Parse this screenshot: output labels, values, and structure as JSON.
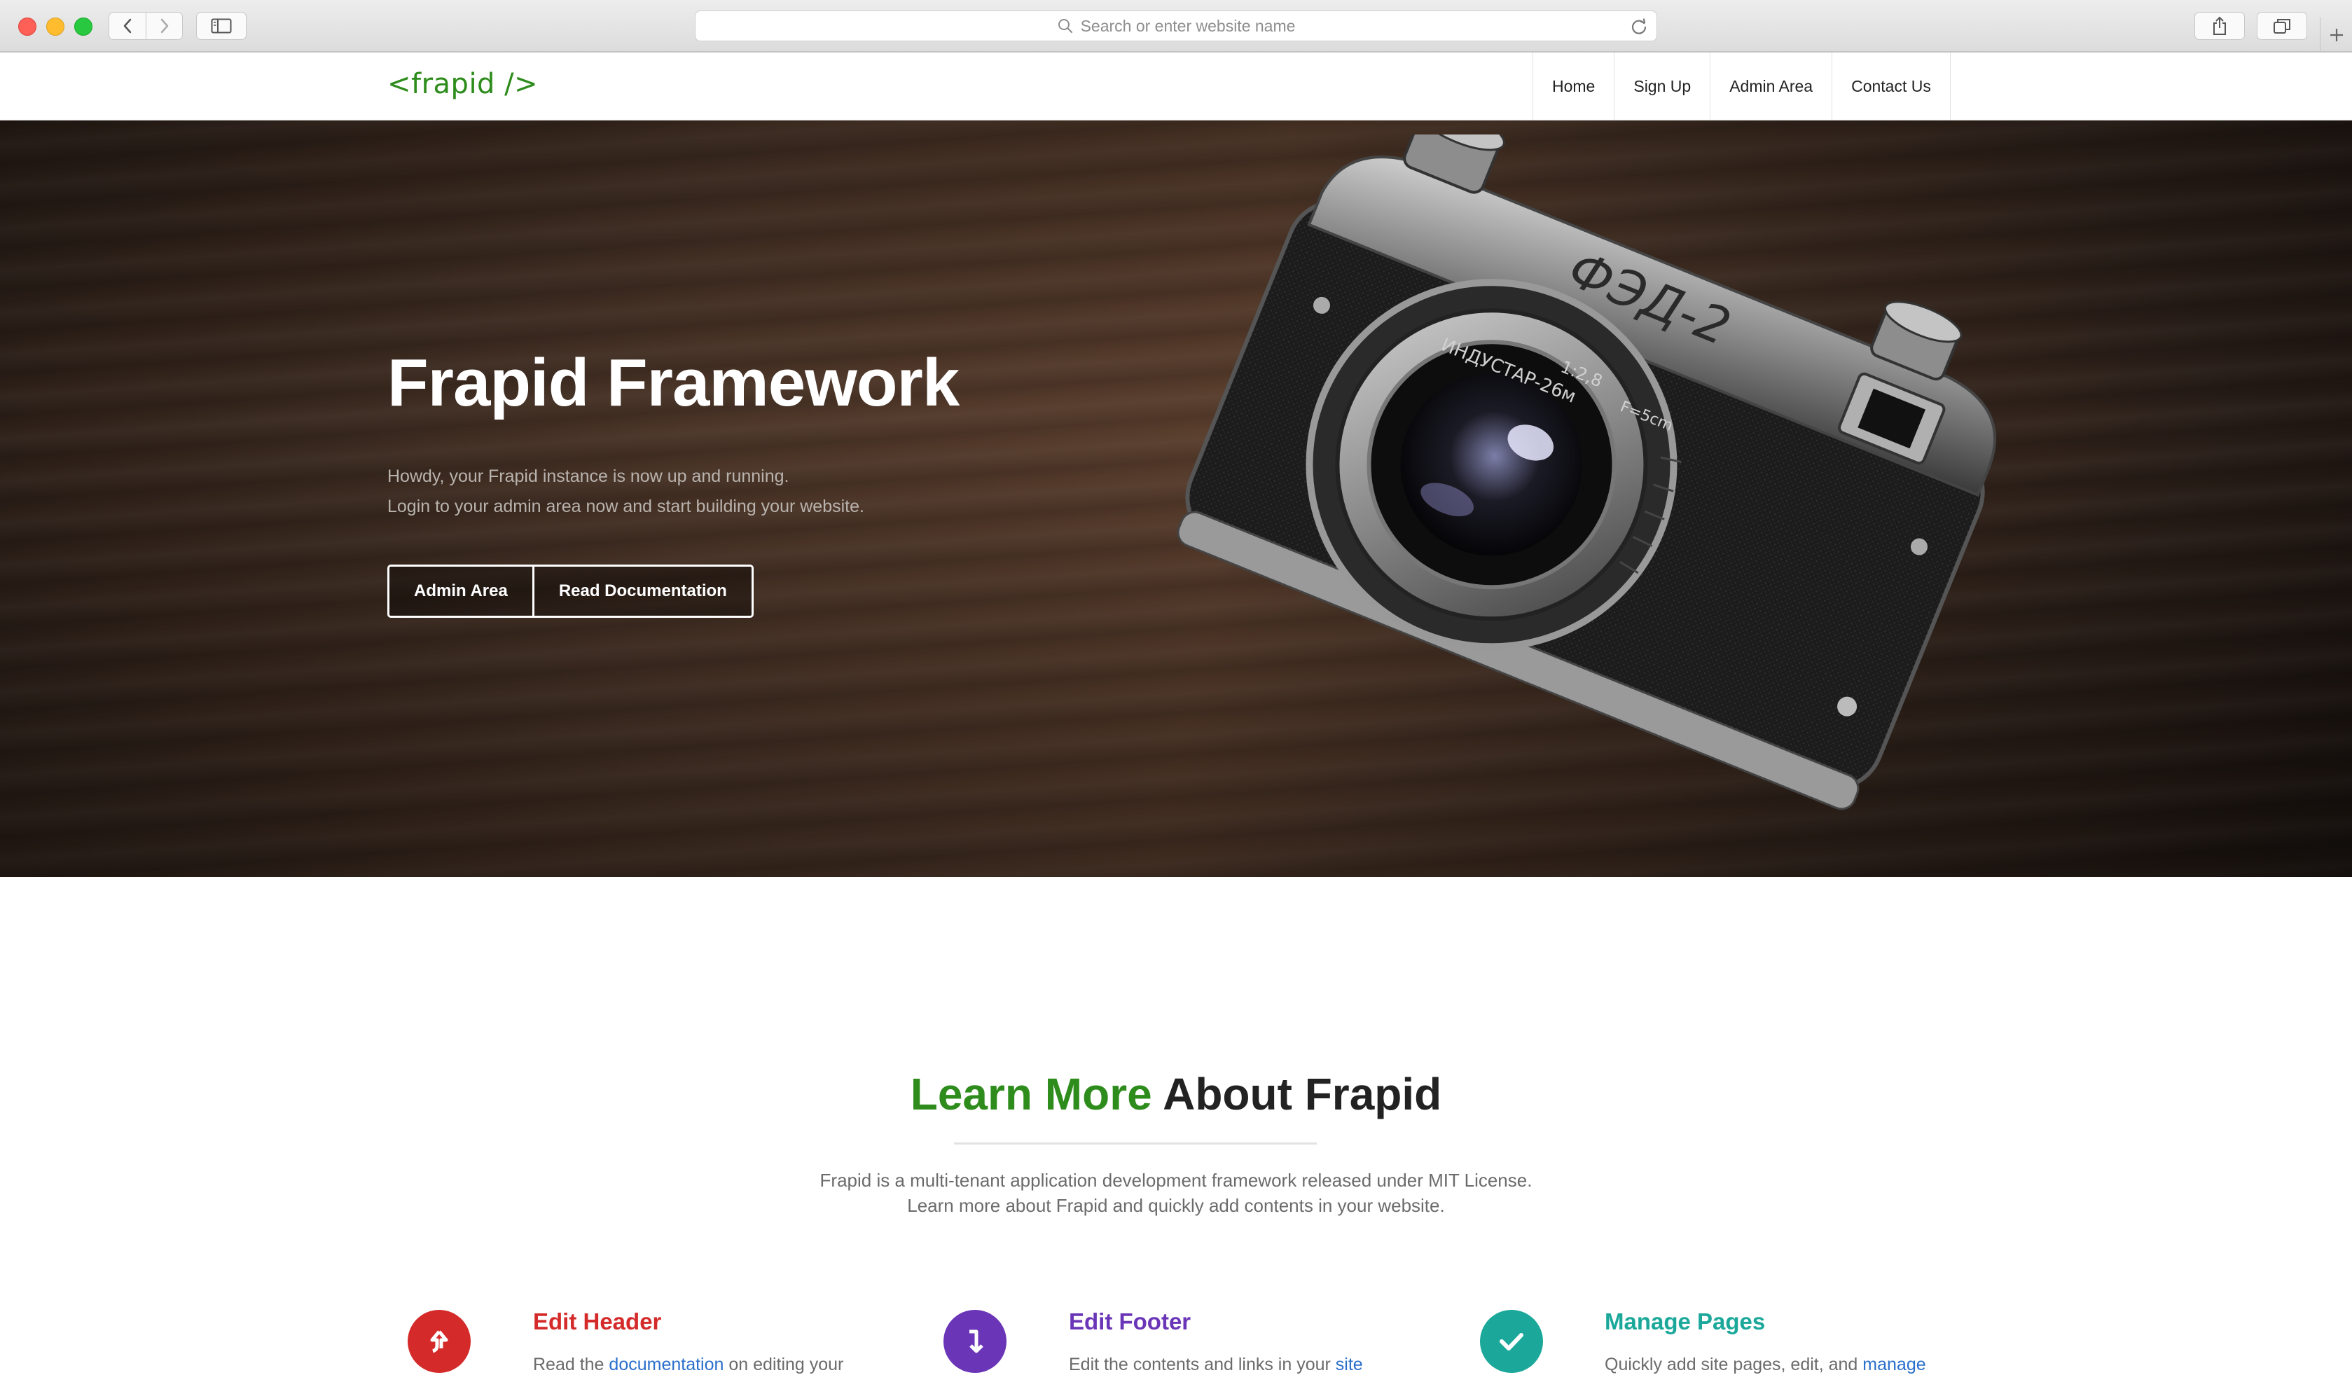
{
  "browser": {
    "url_placeholder": "Search or enter website name"
  },
  "site": {
    "logo": "<frapid />",
    "nav": [
      "Home",
      "Sign Up",
      "Admin Area",
      "Contact Us"
    ]
  },
  "hero": {
    "title": "Frapid Framework",
    "line1": "Howdy, your Frapid instance is now up and running.",
    "line2": "Login to your admin area now and start building your website.",
    "buttons": [
      "Admin Area",
      "Read Documentation"
    ],
    "camera_lettering": [
      "ФЭД-2",
      "ИНДУСТАР-26м",
      "1:2,8",
      "F=5cm"
    ]
  },
  "learn": {
    "title_accent": "Learn More",
    "title_rest": " About Frapid",
    "desc1": "Frapid is a multi-tenant application development framework released under MIT License.",
    "desc2": "Learn more about Frapid and quickly add contents in your website."
  },
  "features": [
    {
      "title": "Edit Header",
      "text_before": "Read the ",
      "link": "documentation",
      "text_after": " on editing your",
      "color": "#d42a2a",
      "icon": "arrow-up-icon"
    },
    {
      "title": "Edit Footer",
      "text_before": "Edit the contents and links in your ",
      "link": "site",
      "text_after": "",
      "color": "#6a35b7",
      "icon": "arrow-down-icon"
    },
    {
      "title": "Manage Pages",
      "text_before": "Quickly add site pages, edit, and ",
      "link": "manage",
      "text_after": "",
      "color": "#1ba89a",
      "icon": "checkmark-icon"
    }
  ],
  "colors": {
    "brand_green": "#2d8c1b",
    "link_blue": "#2a6fcc"
  }
}
